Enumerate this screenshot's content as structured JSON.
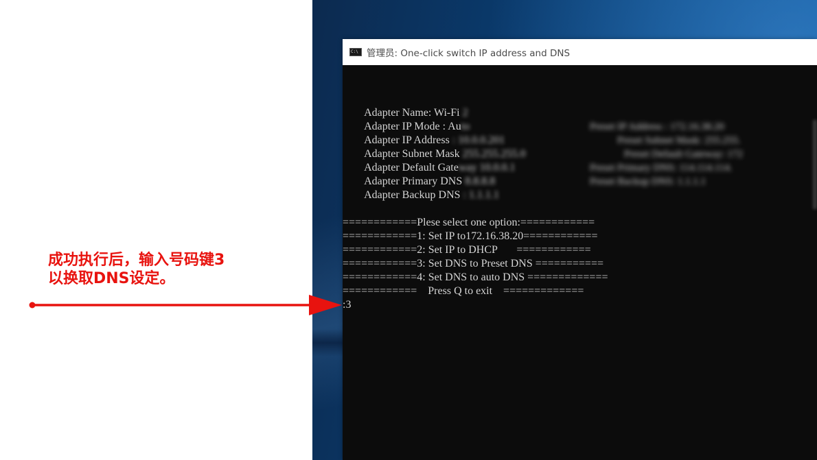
{
  "window": {
    "title": "管理员: One-click switch IP address and DNS",
    "icon": "cmd-icon"
  },
  "adapter_info": [
    {
      "label": "Adapter Name: Wi-Fi",
      "value": "2"
    },
    {
      "label": "Adapter IP Mode : Au",
      "value": "to"
    },
    {
      "label": "Adapter IP Address",
      "value": ": 10.0.0.201"
    },
    {
      "label": "Adapter Subnet Mask",
      "value": "255.255.255.0"
    },
    {
      "label": "Adapter Default Gate",
      "value": "way 10.0.0.1"
    },
    {
      "label": "Adapter Primary DNS",
      "value": "8.8.8.8"
    },
    {
      "label": "Adapter Backup DNS",
      "value": ": 1.1.1.1"
    }
  ],
  "preset_info": [
    "Preset IP Address : 172.16.38.20",
    "Preset Subnet Mask: 255.255.",
    "Preset Default Gateway: 172",
    "Preset Primary DNS: 114.114.114.",
    "Preset Backup DNS: 1.1.1.1"
  ],
  "menu": [
    "============Plese select one option:============",
    "============1: Set IP to172.16.38.20============",
    "============2: Set IP to DHCP       ============",
    "============3: Set DNS to Preset DNS ===========",
    "============4: Set DNS to auto DNS =============",
    "============    Press Q to exit    ============="
  ],
  "prompt": {
    "input": ":3"
  },
  "annotation": {
    "line1": "成功执行后，输入号码键3",
    "line2": "以换取DNS设定。",
    "color": "#e8130f"
  }
}
